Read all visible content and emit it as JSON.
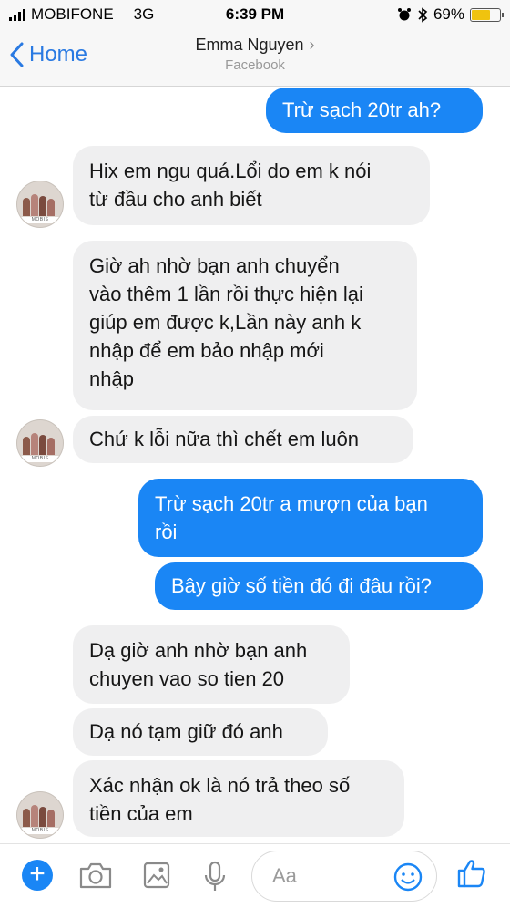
{
  "status_bar": {
    "carrier": "MOBIFONE",
    "network": "3G",
    "time": "6:39 PM",
    "battery": "69%",
    "battery_level": 0.69
  },
  "nav": {
    "back_label": "Home",
    "contact_name": "Emma Nguyen",
    "contact_subtitle": "Facebook"
  },
  "messages": [
    {
      "side": "out",
      "text": "Trừ sạch 20tr ah?"
    },
    {
      "side": "in",
      "lines": [
        "Hix em ngu quá.Lổi do em k nói",
        "từ đầu cho anh biết"
      ]
    },
    {
      "side": "in",
      "lines": [
        "Giờ ah nhờ bạn anh chuyển",
        "vào thêm 1 lần rồi thực hiện lại",
        "giúp em được k,Lần này anh k",
        "nhập để em bảo nhập mới",
        "nhập"
      ]
    },
    {
      "side": "in",
      "text": "Chứ k lỗi nữa thì chết em luôn"
    },
    {
      "side": "out",
      "lines": [
        "Trừ sạch 20tr a mượn của bạn",
        "rồi"
      ]
    },
    {
      "side": "out",
      "text": "Bây giờ số tiền đó đi đâu rồi?"
    },
    {
      "side": "in",
      "lines": [
        "Dạ giờ anh nhờ bạn anh",
        "chuyen vao so tien 20"
      ]
    },
    {
      "side": "in",
      "text": "Dạ nó tạm giữ đó anh"
    },
    {
      "side": "in",
      "lines": [
        "Xác nhận ok là nó trả theo số",
        "tiền của em"
      ]
    }
  ],
  "composer": {
    "placeholder": "Aa",
    "icons": [
      "plus-icon",
      "camera-icon",
      "image-icon",
      "microphone-icon",
      "emoji-icon",
      "like-icon"
    ],
    "accent": "#1a86f5"
  },
  "colors": {
    "outgoing_bubble": "#1a86f5",
    "incoming_bubble": "#efeff0",
    "link": "#2a7ae2"
  }
}
